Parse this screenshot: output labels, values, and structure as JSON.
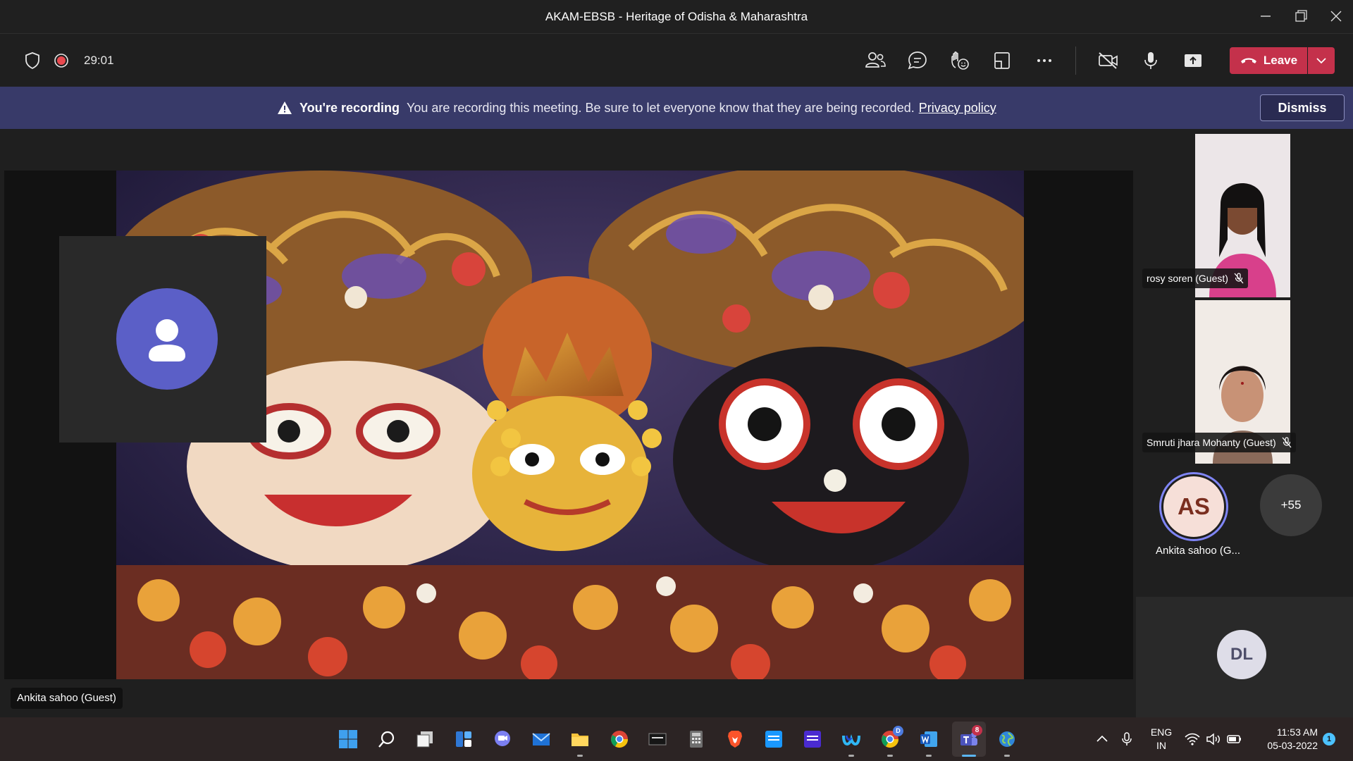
{
  "window": {
    "title": "AKAM-EBSB - Heritage of Odisha & Maharashtra"
  },
  "meeting_bar": {
    "timer": "29:01",
    "leave_label": "Leave"
  },
  "recording_banner": {
    "title": "You're recording",
    "message": "You are recording this meeting. Be sure to let everyone know that they are being recorded.",
    "link": "Privacy policy",
    "dismiss": "Dismiss"
  },
  "stage": {
    "presenter_label": "Ankita sahoo (Guest)"
  },
  "participants": {
    "p1": {
      "name": "rosy soren (Guest)"
    },
    "p2": {
      "name": "Smruti jhara Mohanty (Guest)"
    },
    "p3": {
      "initials": "AS",
      "name": "Ankita sahoo (G..."
    },
    "overflow": "+55",
    "p4": {
      "initials": "DL"
    }
  },
  "taskbar": {
    "lang_top": "ENG",
    "lang_bottom": "IN",
    "time": "11:53 AM",
    "date": "05-03-2022",
    "notification_count": "1",
    "teams_badge": "8",
    "chrome_badge": "D"
  },
  "colors": {
    "accent_purple": "#5b5fc7",
    "banner_bg": "#383a69",
    "leave_red": "#c4314b",
    "recording_red": "#e8494f"
  }
}
